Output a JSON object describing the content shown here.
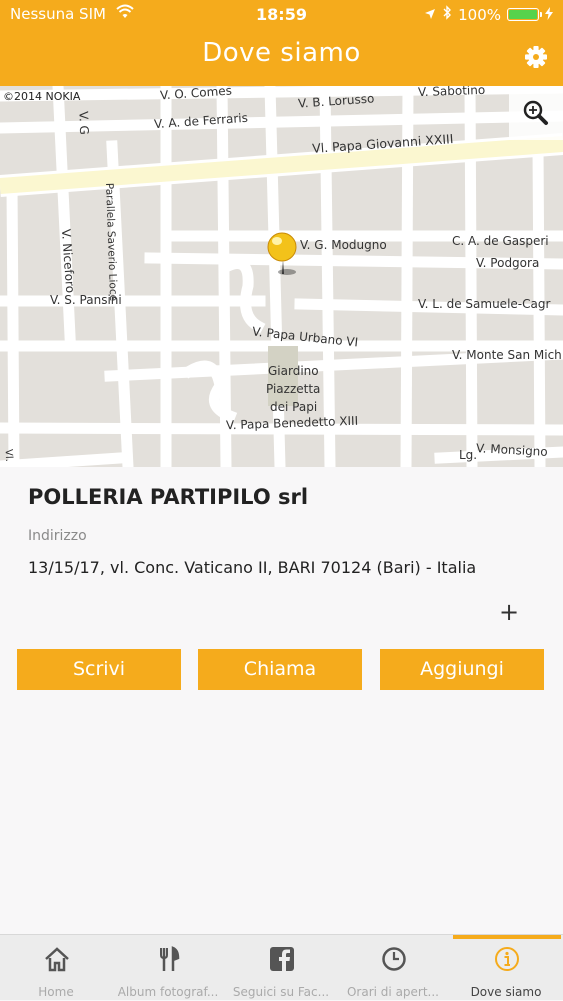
{
  "status_bar": {
    "carrier": "Nessuna SIM",
    "time": "18:59",
    "battery": "100%"
  },
  "header": {
    "title": "Dove siamo",
    "settings_icon": "gear-icon"
  },
  "map": {
    "copyright": "©2014 NOKIA",
    "zoom_icon": "magnifier-icon",
    "streets": {
      "comes": "V. O. Comes",
      "lorusso": "V. B. Lorusso",
      "sabotino": "V. Sabotino",
      "ferraris": "V. A. de Ferraris",
      "papa_giovanni": "Vl. Papa Giovanni XXIII",
      "parallela": "Parallela Saverio Lioce",
      "niceforo": "V. Niceforo",
      "modugno": "V. G. Modugno",
      "gasperi": "C. A. de Gasperi",
      "podgora": "V. Podgora",
      "pansini": "V. S. Pansini",
      "samuele": "V. L. de Samuele-Cagr",
      "papa_urbano": "V. Papa Urbano VI",
      "monte_san": "V. Monte San Mich",
      "giardino_1": "Giardino",
      "giardino_2": "Piazzetta",
      "giardino_3": "dei Papi",
      "benedetto": "V. Papa Benedetto XIII",
      "monsigno": "V. Monsigno",
      "lg": "Lg.",
      "vg": "V. G",
      "vl": "Vl."
    }
  },
  "business": {
    "name": "POLLERIA PARTIPILO srl",
    "address_label": "Indirizzo",
    "address": "13/15/17, vl. Conc. Vaticano II, BARI 70124 (Bari) - Italia",
    "more_label": "+"
  },
  "actions": {
    "write": "Scrivi",
    "call": "Chiama",
    "add": "Aggiungi"
  },
  "tabs": [
    {
      "label": "Home",
      "icon": "home-icon"
    },
    {
      "label": "Album fotograf...",
      "icon": "cutlery-icon"
    },
    {
      "label": "Seguici su Fac...",
      "icon": "facebook-icon"
    },
    {
      "label": "Orari di apert...",
      "icon": "clock-icon"
    },
    {
      "label": "Dove siamo",
      "icon": "info-icon",
      "active": true
    }
  ],
  "colors": {
    "accent": "#f5ab1c",
    "battery": "#56d34c",
    "map_bg": "#e3e0db",
    "main_road": "#fbf7d0"
  }
}
